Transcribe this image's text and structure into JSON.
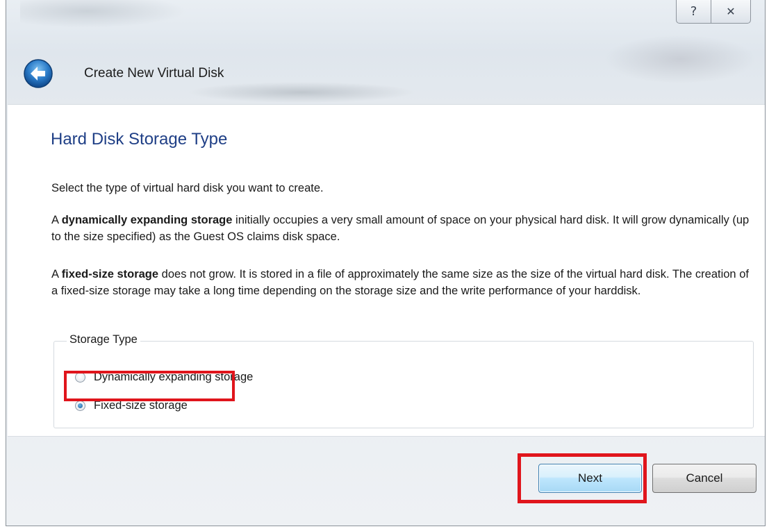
{
  "titlebar": {
    "help_glyph": "?",
    "close_glyph": "✕"
  },
  "wizard": {
    "title": "Create New Virtual Disk"
  },
  "page": {
    "title": "Hard Disk Storage Type",
    "intro": "Select the type of virtual hard disk you want to create.",
    "dynamic_paragraph": {
      "prefix": "A ",
      "bold": "dynamically expanding storage",
      "rest": " initially occupies a very small amount of space on your physical hard disk. It will grow dynamically (up to the size specified) as the Guest OS claims disk space."
    },
    "fixed_paragraph": {
      "prefix": "A ",
      "bold": "fixed-size storage",
      "rest": " does not grow. It is stored in a file of approximately the same size as the size of the virtual hard disk. The creation of a fixed-size storage may take a long time depending on the storage size and the write performance of your harddisk."
    }
  },
  "storage_type": {
    "legend": "Storage Type",
    "options": [
      {
        "label": "Dynamically expanding storage",
        "selected": false
      },
      {
        "label": "Fixed-size storage",
        "selected": true
      }
    ]
  },
  "buttons": {
    "next": "Next",
    "cancel": "Cancel"
  },
  "colors": {
    "highlight": "#e0151c",
    "page_title": "#1f3f86"
  }
}
